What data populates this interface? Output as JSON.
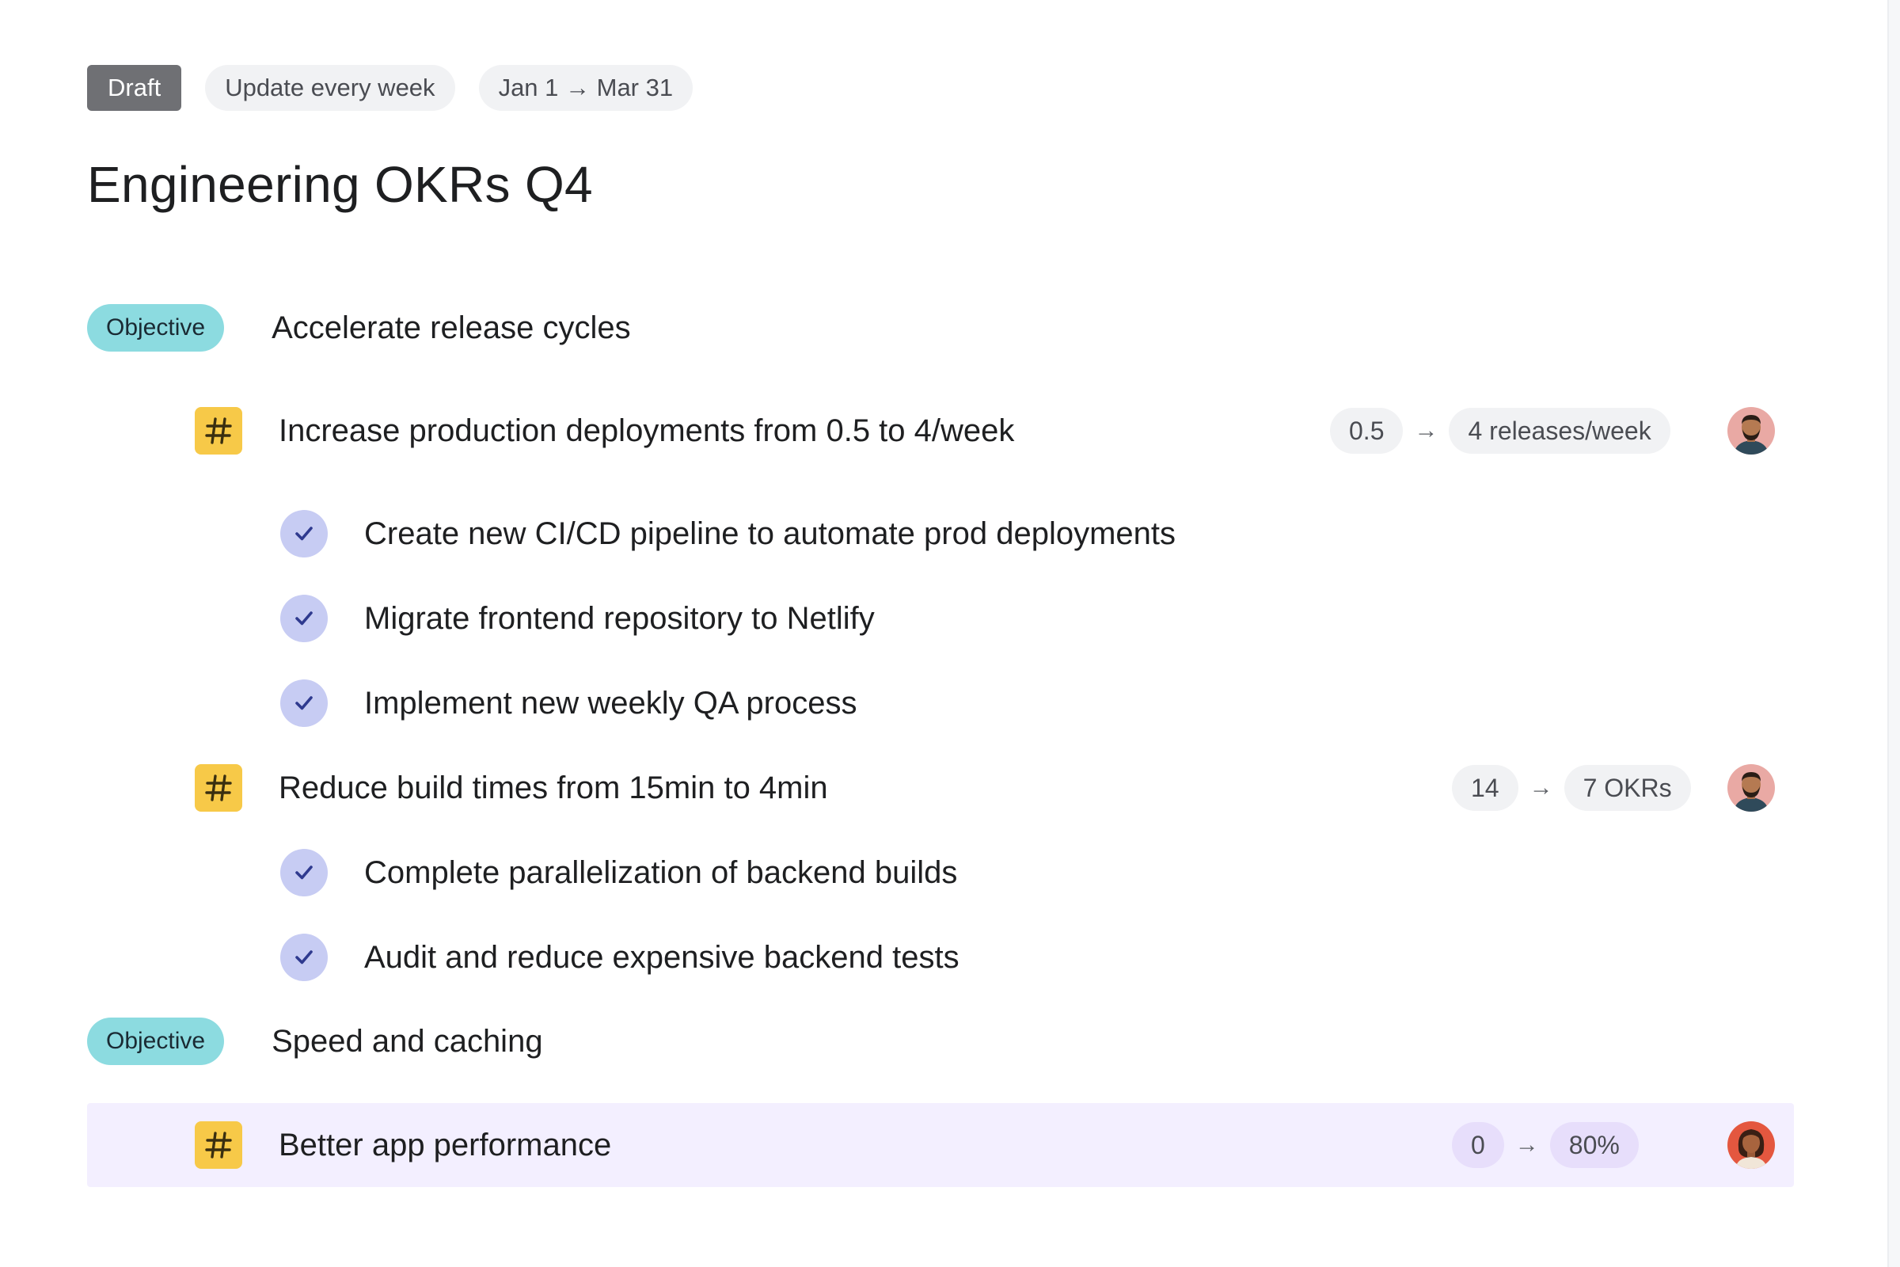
{
  "header": {
    "status": "Draft",
    "cadence": "Update every week",
    "date_range": "Jan 1 → Mar 31"
  },
  "page_title": "Engineering OKRs Q4",
  "objectives": [
    {
      "badge": "Objective",
      "title": "Accelerate release cycles",
      "key_results": [
        {
          "title": "Increase production deployments from 0.5 to 4/week",
          "start": "0.5",
          "target": "4 releases/week",
          "avatar": "male-avatar",
          "tasks": [
            "Create new CI/CD pipeline to automate prod deployments",
            "Migrate frontend repository to Netlify",
            "Implement new weekly QA process"
          ]
        },
        {
          "title": "Reduce build times from 15min to 4min",
          "start": "14",
          "target": "7 OKRs",
          "avatar": "male-avatar",
          "tasks": [
            "Complete parallelization of backend builds",
            "Audit and reduce expensive backend tests"
          ]
        }
      ]
    },
    {
      "badge": "Objective",
      "title": "Speed and caching",
      "key_results": [
        {
          "title": "Better app performance",
          "start": "0",
          "target": "80%",
          "avatar": "female-avatar",
          "tasks": []
        }
      ]
    }
  ],
  "icons": {
    "key_result": "hash-icon",
    "task": "check-icon",
    "arrow": "arrow-right-icon"
  },
  "colors": {
    "objective_badge": "#8cdbe0",
    "key_result_icon": "#f7c948",
    "task_check": "#c7ccf3",
    "check_mark": "#2f3a8f",
    "highlight_row": "#f3efff",
    "draft_pill": "#6f7074"
  }
}
